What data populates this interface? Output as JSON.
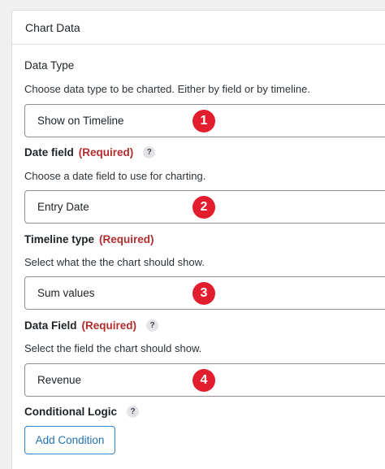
{
  "panel": {
    "title": "Chart Data"
  },
  "data_type": {
    "label": "Data Type",
    "description": "Choose data type to be charted. Either by field or by timeline.",
    "value": "Show on Timeline",
    "badge": "1"
  },
  "date_field": {
    "label": "Date field",
    "required": "(Required)",
    "help": "?",
    "description": "Choose a date field to use for charting.",
    "value": "Entry Date",
    "badge": "2"
  },
  "timeline_type": {
    "label": "Timeline type",
    "required": "(Required)",
    "description": "Select what the the chart should show.",
    "value": "Sum values",
    "badge": "3"
  },
  "data_field": {
    "label": "Data Field",
    "required": "(Required)",
    "help": "?",
    "description": "Select the field the chart should show.",
    "value": "Revenue",
    "badge": "4"
  },
  "conditional_logic": {
    "label": "Conditional Logic",
    "help": "?",
    "button_label": "Add Condition"
  },
  "colors": {
    "badge": "#e11d2e",
    "required": "#b32d2e",
    "button_text": "#2271b1"
  }
}
